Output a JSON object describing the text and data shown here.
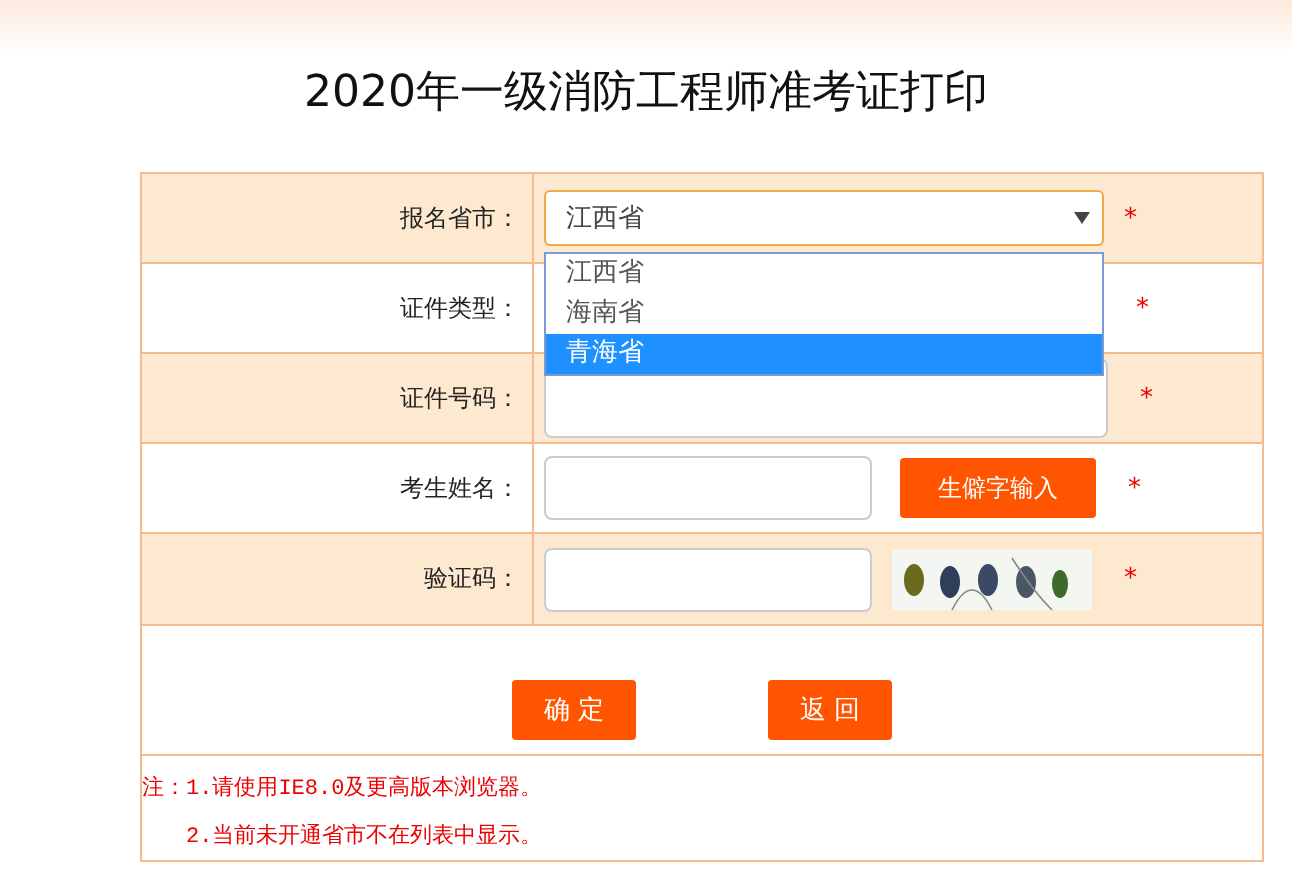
{
  "title": "2020年一级消防工程师准考证打印",
  "fields": [
    {
      "label": "报名省市：",
      "kind": "select",
      "value": "江西省",
      "required_mark": "*"
    },
    {
      "label": "证件类型：",
      "kind": "covered",
      "required_mark": "*"
    },
    {
      "label": "证件号码：",
      "kind": "input",
      "required_mark": "*"
    },
    {
      "label": "考生姓名：",
      "kind": "input_button",
      "button": "生僻字输入",
      "required_mark": "*"
    },
    {
      "label": "验证码：",
      "kind": "captcha",
      "required_mark": "*"
    }
  ],
  "dropdown": {
    "options": [
      {
        "label": "江西省",
        "selected": false
      },
      {
        "label": "海南省",
        "selected": false
      },
      {
        "label": "青海省",
        "selected": true
      }
    ]
  },
  "buttons": [
    "确 定",
    "返 回"
  ],
  "notes": [
    "注：1.请使用IE8.0及更高版本浏览器。",
    "2.当前未开通省市不在列表中显示。"
  ]
}
